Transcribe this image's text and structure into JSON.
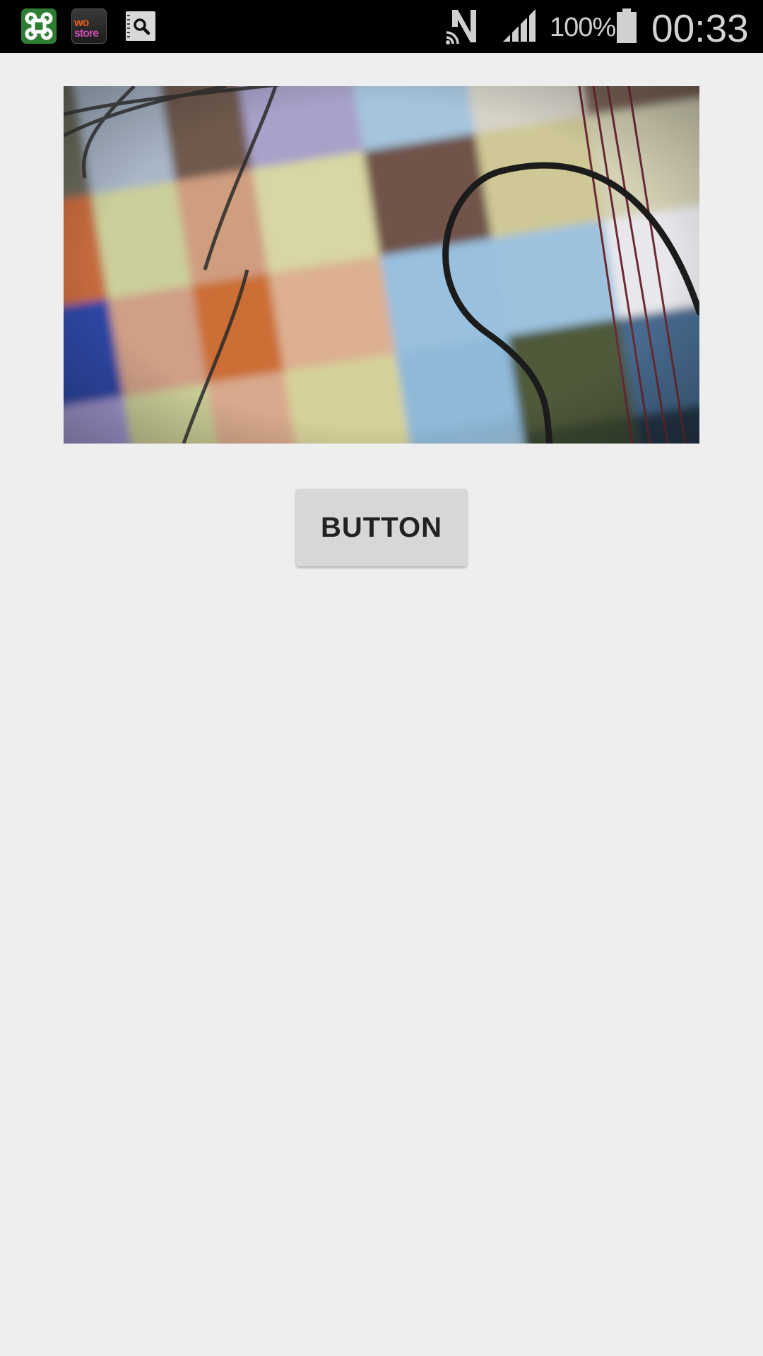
{
  "status_bar": {
    "notification_icons": [
      "app-launcher-icon",
      "wo-store-icon",
      "search-notes-icon"
    ],
    "store_icon_text_top": "wo",
    "store_icon_text_bottom": "store",
    "indicators": [
      "nfc-icon",
      "signal-icon",
      "battery-icon"
    ],
    "battery_percent": "100%",
    "battery_level": 1.0,
    "time": "00:33"
  },
  "main": {
    "photo_subject": "camera-preview-image",
    "button_label": "BUTTON"
  },
  "colors": {
    "background": "#eeeeef",
    "status_bar": "#000000",
    "button": "#d6d7d7",
    "button_text": "#222222"
  }
}
